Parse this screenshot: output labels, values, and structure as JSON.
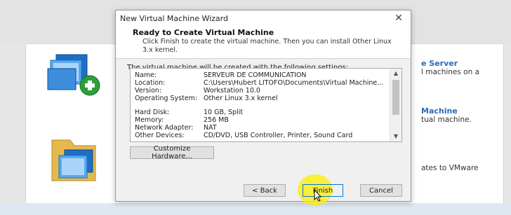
{
  "dialog": {
    "title": "New Virtual Machine Wizard",
    "close_icon": "close-icon",
    "header_title": "Ready to Create Virtual Machine",
    "header_subtitle_line1": "Click Finish to create the virtual machine. Then you can install Other Linux",
    "header_subtitle_line2": "3.x kernel.",
    "intro_text": "The virtual machine will be created with the following settings:",
    "settings": [
      {
        "key": "Name:",
        "value": "SERVEUR DE COMMUNICATION"
      },
      {
        "key": "Location:",
        "value": "C:\\Users\\Hubert LITOFO\\Documents\\Virtual Machine..."
      },
      {
        "key": "Version:",
        "value": "Workstation 10.0"
      },
      {
        "key": "Operating System:",
        "value": "Other Linux 3.x kernel"
      },
      {
        "key": "Hard Disk:",
        "value": "10 GB, Split"
      },
      {
        "key": "Memory:",
        "value": "256 MB"
      },
      {
        "key": "Network Adapter:",
        "value": "NAT"
      },
      {
        "key": "Other Devices:",
        "value": "CD/DVD, USB Controller, Printer, Sound Card"
      }
    ],
    "customize_label": "Customize Hardware...",
    "back_label": "< Back",
    "finish_label": "Finish",
    "cancel_label": "Cancel"
  },
  "background": {
    "item1_head": "e Server",
    "item1_sub": "l machines on a",
    "item2_head": "Machine",
    "item2_sub": "tual machine.",
    "item3_text": "ates to VMware"
  },
  "colors": {
    "accent": "#0078d7",
    "link_blue": "#2a6ab5",
    "highlight": "#ffee00"
  }
}
